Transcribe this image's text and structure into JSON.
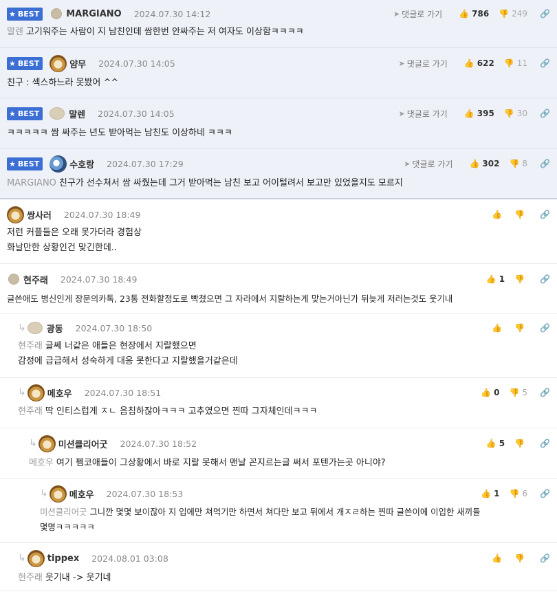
{
  "labels": {
    "best": "BEST",
    "goto": "댓글로 가기"
  },
  "comments": [
    {
      "nick": "MARGIANO",
      "date": "2024.07.30 14:12",
      "ref": "말렌",
      "text": "고기워주는 사람이 지 남친인데 쌈한번 안싸주는 저 여자도 이상함ㅋㅋㅋㅋ",
      "up": "786",
      "down": "249"
    },
    {
      "nick": "얌무",
      "date": "2024.07.30 14:05",
      "ref": "",
      "text": "친구 : 섹스하느라 못봤어 ^^",
      "up": "622",
      "down": "11"
    },
    {
      "nick": "말렌",
      "date": "2024.07.30 14:05",
      "ref": "",
      "text": "ㅋㅋㅋㅋㅋ 쌈 싸주는 년도 받아먹는 남친도 이상하네 ㅋㅋㅋ",
      "up": "395",
      "down": "30"
    },
    {
      "nick": "수호랑",
      "date": "2024.07.30 17:29",
      "ref": "MARGIANO",
      "text": "친구가 선수쳐서 쌈 싸줬는데 그거 받아먹는 남친 보고 어이털려서 보고만 있었을지도 모르지",
      "up": "302",
      "down": "8"
    },
    {
      "nick": "쌍사러",
      "date": "2024.07.30 18:49",
      "ref": "",
      "line1": "저런 커플들은 오래 못가더라 경험상",
      "line2": "화날만한 상황인건 맞긴한데..",
      "up": "",
      "down": ""
    },
    {
      "nick": "현주래",
      "date": "2024.07.30 18:49",
      "ref": "",
      "text": "글쓴애도 병신인게 장문의카톡, 23통 전화할정도로 빡쳤으면 그 자라에서 지랄하는게 맞는거아닌가 뒤늦게 저러는것도 웃기내",
      "up": "1",
      "down": ""
    },
    {
      "nick": "광동",
      "date": "2024.07.30 18:50",
      "ref": "현주래",
      "line1": "글쎄 너같은 애들은 현장에서 지랄했으면",
      "line2": "감정에 급급해서 성숙하게 대응 못한다고 지랄했을거같은데",
      "up": "",
      "down": ""
    },
    {
      "nick": "메호우",
      "date": "2024.07.30 18:51",
      "ref": "현주래",
      "text": "딱 인티스럽게 ㅈㄴ 음침하잖아ㅋㅋㅋ 고추였으면 찐따 그자체인데ㅋㅋㅋ",
      "up": "0",
      "down": "5"
    },
    {
      "nick": "미션클리어굿",
      "date": "2024.07.30 18:52",
      "ref": "메호우",
      "text": "여기 펨코애들이 그상황에서 바로 지랄 못해서 맨날 꼰지르는글 써서 포텐가는곳 아니야?",
      "up": "5",
      "down": ""
    },
    {
      "nick": "메호우",
      "date": "2024.07.30 18:53",
      "ref": "미션클리어굿",
      "line1": "그니깐 몇몇 보이잖아 지 입에만 쳐먹기만 하면서 쳐다만 보고 뒤에서 개ㅈㄹ하는 찐따 글쓴이에 이입한 새끼들",
      "line2": "몇명ㅋㅋㅋㅋㅋ",
      "up": "1",
      "down": "6"
    },
    {
      "nick": "tippex",
      "date": "2024.08.01 03:08",
      "ref": "현주래",
      "text": "웃기내 -> 웃기네",
      "up": "",
      "down": ""
    }
  ]
}
